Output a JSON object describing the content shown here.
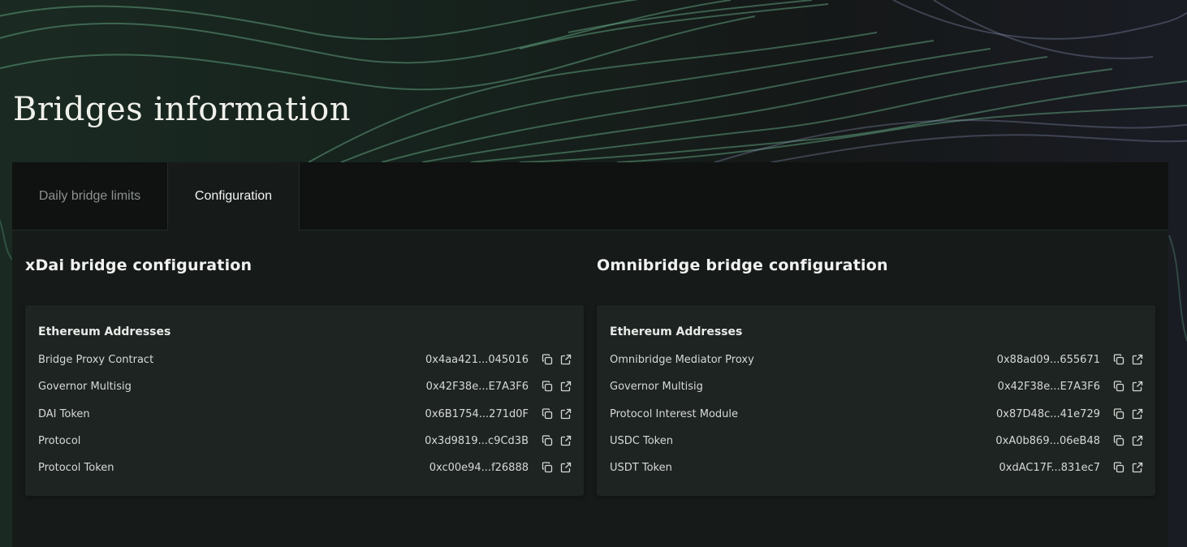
{
  "page": {
    "title": "Bridges information"
  },
  "tabs": {
    "limits_label": "Daily bridge limits",
    "config_label": "Configuration"
  },
  "xdai": {
    "title": "xDai bridge configuration",
    "card_heading": "Ethereum Addresses",
    "rows": [
      {
        "label": "Bridge Proxy Contract",
        "value": "0x4aa421...045016"
      },
      {
        "label": "Governor Multisig",
        "value": "0x42F38e...E7A3F6"
      },
      {
        "label": "DAI Token",
        "value": "0x6B1754...271d0F"
      },
      {
        "label": "Protocol",
        "value": "0x3d9819...c9Cd3B"
      },
      {
        "label": "Protocol Token",
        "value": "0xc00e94...f26888"
      }
    ]
  },
  "omni": {
    "title": "Omnibridge bridge configuration",
    "card_heading": "Ethereum Addresses",
    "rows": [
      {
        "label": "Omnibridge Mediator Proxy",
        "value": "0x88ad09...655671"
      },
      {
        "label": "Governor Multisig",
        "value": "0x42F38e...E7A3F6"
      },
      {
        "label": "Protocol Interest Module",
        "value": "0x87D48c...41e729"
      },
      {
        "label": "USDC Token",
        "value": "0xA0b869...06eB48"
      },
      {
        "label": "USDT Token",
        "value": "0xdAC17F...831ec7"
      }
    ]
  },
  "icons": {
    "copy": "copy-icon",
    "external_link": "external-link-icon"
  },
  "colors": {
    "background": "#141816",
    "panel": "#161b19",
    "card": "#1e2422",
    "text": "#e6e8e6"
  }
}
